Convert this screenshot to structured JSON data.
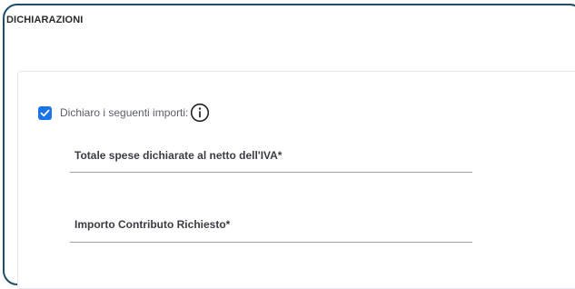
{
  "section": {
    "title": "DICHIARAZIONI"
  },
  "declaration": {
    "checked": true,
    "checkbox_label": "Dichiaro i seguenti importi:",
    "info_icon": "info-circle-icon"
  },
  "fields": [
    {
      "label": "Totale spese dichiarate al netto dell'IVA*",
      "value": ""
    },
    {
      "label": "Importo Contributo Richiesto*",
      "value": ""
    }
  ],
  "colors": {
    "frame_border": "#1f4e6a",
    "checkbox_fill": "#1a73e8",
    "field_underline": "#9aa0a6"
  }
}
